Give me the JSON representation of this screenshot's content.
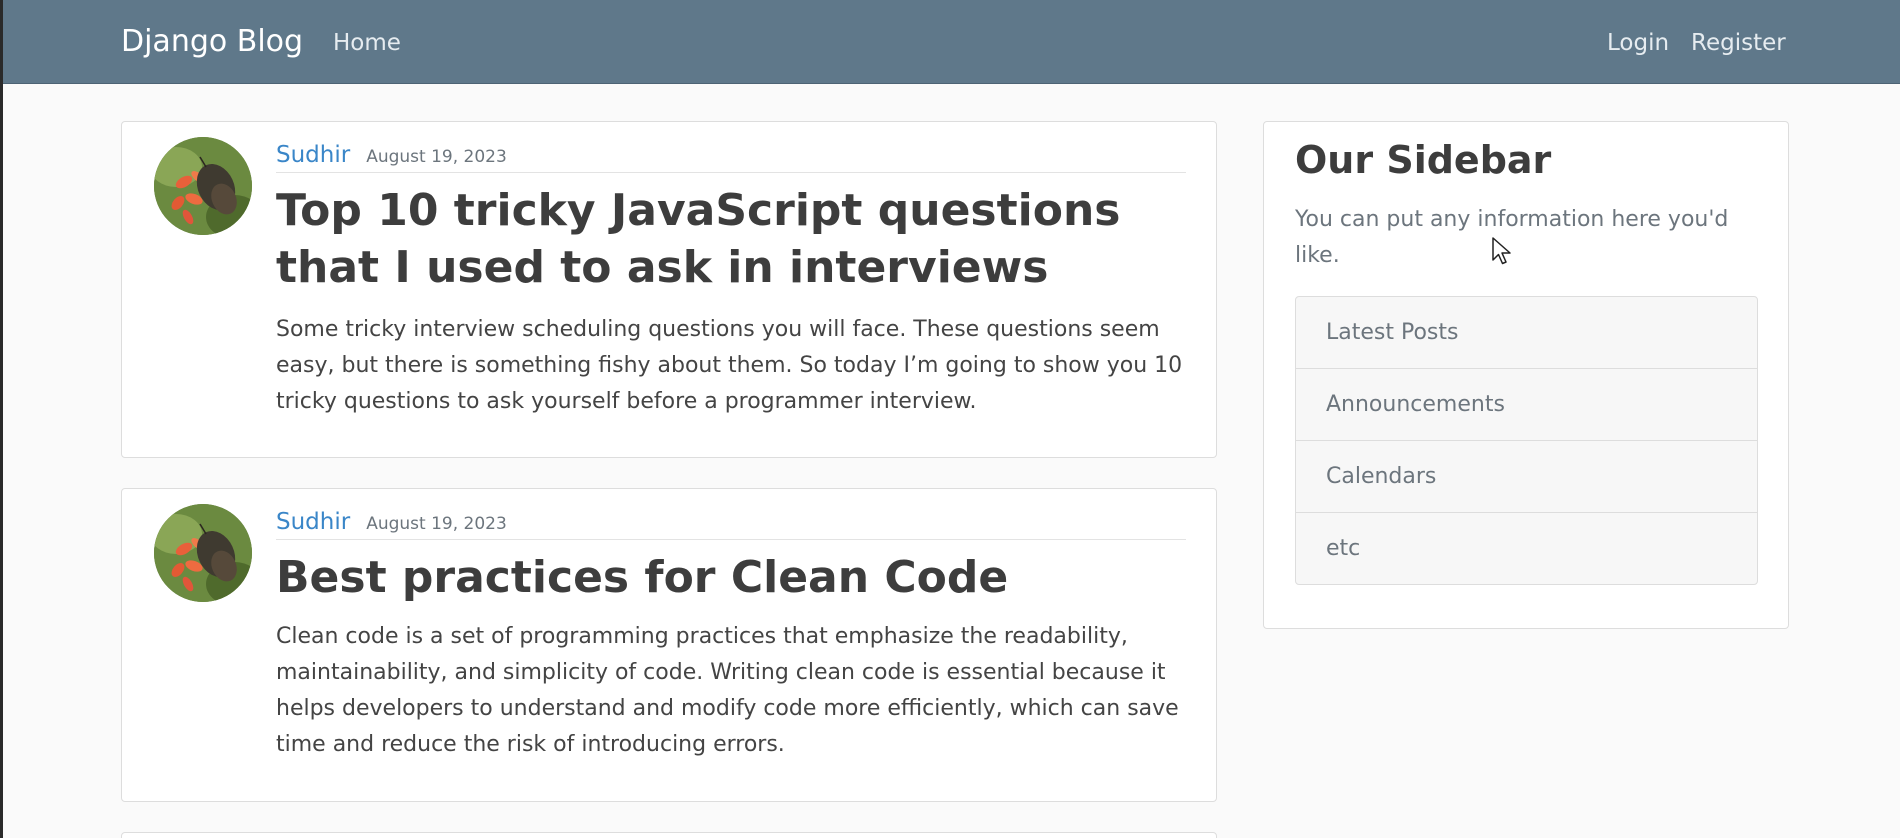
{
  "navbar": {
    "brand": "Django Blog",
    "links": {
      "home": "Home",
      "login": "Login",
      "register": "Register"
    }
  },
  "posts": [
    {
      "author": "Sudhir",
      "date": "August 19, 2023",
      "title": "Top 10 tricky JavaScript questions that I used to ask in interviews",
      "excerpt": "Some tricky interview scheduling questions you will face. These questions seem easy, but there is something fishy about them. So today I’m going to show you 10 tricky questions to ask yourself before a programmer interview.",
      "avatar_icon": "butterfly-avatar"
    },
    {
      "author": "Sudhir",
      "date": "August 19, 2023",
      "title": "Best practices for Clean Code",
      "excerpt": "Clean code is a set of programming practices that emphasize the readability, maintainability, and simplicity of code. Writing clean code is essential because it helps developers to understand and modify code more efficiently, which can save time and reduce the risk of introducing errors.",
      "avatar_icon": "butterfly-avatar"
    }
  ],
  "sidebar": {
    "title": "Our Sidebar",
    "description": "You can put any information here you'd like.",
    "items": [
      {
        "label": "Latest Posts"
      },
      {
        "label": "Announcements"
      },
      {
        "label": "Calendars"
      },
      {
        "label": "etc"
      }
    ]
  },
  "colors": {
    "navbar": "#5f788a",
    "link": "#3a86c8",
    "page_background": "#fafafa"
  }
}
